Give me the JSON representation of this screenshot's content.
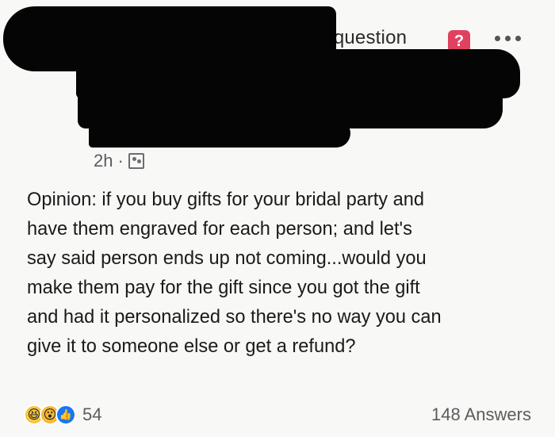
{
  "header": {
    "asked_text": "d a question",
    "question_badge": "?",
    "more_label": "•••"
  },
  "meta": {
    "time": "2h",
    "separator": "·"
  },
  "post": {
    "text": "Opinion: if you buy gifts for your bridal party and\nhave them engraved for each person; and let's\nsay said person ends up not coming...would you\nmake them pay for the gift since you got the gift\nand had it personalized so there's no way you can\ngive it to someone else or get a refund?"
  },
  "footer": {
    "reaction_icons": [
      "haha-icon",
      "wow-icon",
      "like-icon"
    ],
    "reaction_count": "54",
    "answers": "148 Answers"
  },
  "colors": {
    "badge": "#e0415f",
    "like": "#1877f2",
    "redaction": "#050505"
  }
}
